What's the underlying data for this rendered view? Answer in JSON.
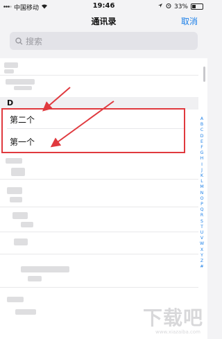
{
  "status_bar": {
    "carrier": "中国移动",
    "time": "19:46",
    "battery_text": "33%",
    "battery_level": 0.33
  },
  "nav": {
    "title": "通讯录",
    "cancel_label": "取消"
  },
  "search": {
    "placeholder": "搜索"
  },
  "section": {
    "letter": "D"
  },
  "contacts": [
    {
      "name": "第二个"
    },
    {
      "name": "第一个"
    }
  ],
  "index_letters": [
    "A",
    "B",
    "C",
    "D",
    "E",
    "F",
    "G",
    "H",
    "I",
    "J",
    "K",
    "L",
    "M",
    "N",
    "O",
    "P",
    "Q",
    "R",
    "S",
    "T",
    "U",
    "V",
    "W",
    "X",
    "Y",
    "Z",
    "#"
  ],
  "watermark": {
    "text": "下载吧",
    "subtext": "www.xiazaiba.com"
  },
  "colors": {
    "accent": "#1b7fe8",
    "highlight": "#e0393e",
    "arrow": "#e0393e"
  }
}
